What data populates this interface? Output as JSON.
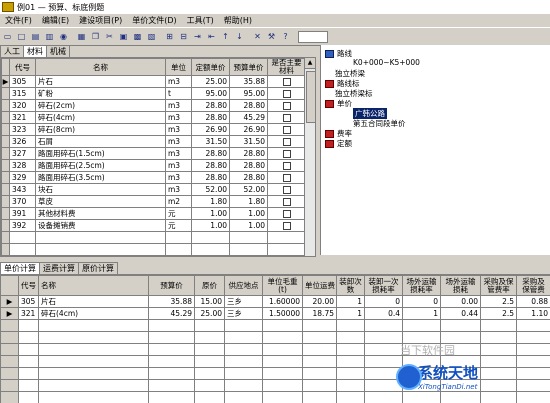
{
  "window": {
    "title": "例01 — 预算、标底例题"
  },
  "menu": [
    "文件(F)",
    "编辑(E)",
    "建设项目(P)",
    "单价文件(D)",
    "工具(T)",
    "帮助(H)"
  ],
  "toolbar": {
    "icons": [
      "open-icon",
      "new-icon",
      "save-icon",
      "print-icon",
      "preview-icon",
      "save-as-icon",
      "copy-icon",
      "cut-icon",
      "paste-icon",
      "calc-icon",
      "report-icon",
      "tree-expand-icon",
      "tree-collapse-icon",
      "indent-icon",
      "outdent-icon",
      "move-up-icon",
      "move-down-icon",
      "delete-icon",
      "tool-icon",
      "help-icon"
    ]
  },
  "top_tabs": [
    "人工",
    "材料",
    "机械"
  ],
  "materials": {
    "columns": [
      "代号",
      "名称",
      "单位",
      "定额单价",
      "预算单价",
      "是否主要材料"
    ],
    "rows": [
      {
        "code": "305",
        "name": "片石",
        "unit": "m3",
        "quota": "25.00",
        "budget": "35.88"
      },
      {
        "code": "315",
        "name": "矿粉",
        "unit": "t",
        "quota": "95.00",
        "budget": "95.00"
      },
      {
        "code": "320",
        "name": "碎石(2cm)",
        "unit": "m3",
        "quota": "28.80",
        "budget": "28.80"
      },
      {
        "code": "321",
        "name": "碎石(4cm)",
        "unit": "m3",
        "quota": "28.80",
        "budget": "45.29"
      },
      {
        "code": "323",
        "name": "碎石(8cm)",
        "unit": "m3",
        "quota": "26.90",
        "budget": "26.90"
      },
      {
        "code": "326",
        "name": "石屑",
        "unit": "m3",
        "quota": "31.50",
        "budget": "31.50"
      },
      {
        "code": "327",
        "name": "路面用碎石(1.5cm)",
        "unit": "m3",
        "quota": "28.80",
        "budget": "28.80"
      },
      {
        "code": "328",
        "name": "路面用碎石(2.5cm)",
        "unit": "m3",
        "quota": "28.80",
        "budget": "28.80"
      },
      {
        "code": "329",
        "name": "路面用碎石(3.5cm)",
        "unit": "m3",
        "quota": "28.80",
        "budget": "28.80"
      },
      {
        "code": "343",
        "name": "块石",
        "unit": "m3",
        "quota": "52.00",
        "budget": "52.00"
      },
      {
        "code": "370",
        "name": "草皮",
        "unit": "m2",
        "quota": "1.80",
        "budget": "1.80"
      },
      {
        "code": "391",
        "name": "其他材料费",
        "unit": "元",
        "quota": "1.00",
        "budget": "1.00"
      },
      {
        "code": "392",
        "name": "设备摊销费",
        "unit": "元",
        "quota": "1.00",
        "budget": "1.00"
      }
    ]
  },
  "tree": {
    "nodes": [
      {
        "label": "路线"
      },
      {
        "label": "K0+000~K5+000"
      },
      {
        "label": "独立桥梁"
      },
      {
        "label": "路线标"
      },
      {
        "label": "独立桥梁标"
      },
      {
        "label": "单价"
      },
      {
        "label": "广韩公路"
      },
      {
        "label": "第五合同段单价"
      },
      {
        "label": "费率"
      },
      {
        "label": "定额"
      }
    ]
  },
  "bottom_tabs": [
    "单价计算",
    "运费计算",
    "原价计算"
  ],
  "unit_price": {
    "columns": [
      "代号",
      "名称",
      "预算价",
      "原价",
      "供应地点",
      "单位毛重(t)",
      "单位运费",
      "装卸次数",
      "装卸一次损耗率",
      "场外运输损耗率",
      "场外运输损耗",
      "采购及保管费率",
      "采购及保管费",
      ""
    ],
    "rows": [
      {
        "code": "305",
        "name": "片石",
        "budget": "35.88",
        "orig": "15.00",
        "place": "三乡",
        "weight": "1.60000",
        "freight": "20.00",
        "times": "1",
        "loss1": "0",
        "rate": "0",
        "loss2": "0.00",
        "prate": "2.5",
        "pfee": "0.88"
      },
      {
        "code": "321",
        "name": "碎石(4cm)",
        "budget": "45.29",
        "orig": "25.00",
        "place": "三乡",
        "weight": "1.50000",
        "freight": "18.75",
        "times": "1",
        "loss1": "0.4",
        "rate": "1",
        "loss2": "0.44",
        "prate": "2.5",
        "pfee": "1.10"
      }
    ]
  },
  "watermark": "当下软件园",
  "brand": {
    "name": "系统天地",
    "url": "XiTongTianDi.net"
  }
}
